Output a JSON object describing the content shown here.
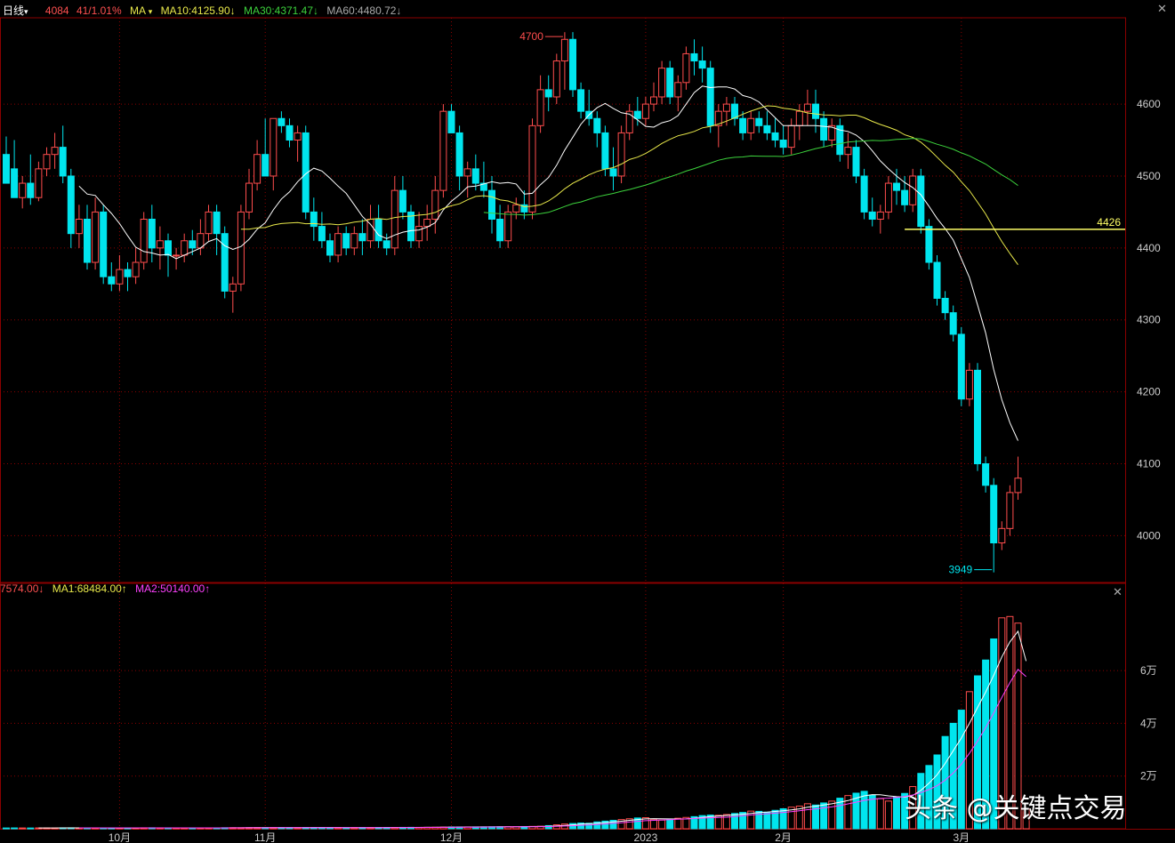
{
  "header": {
    "period": "日线",
    "period_arrow": "▾",
    "price": "4084",
    "change": "41/1.01%",
    "ma_label": "MA",
    "ma_arrow": "▾",
    "ma10": "MA10:4125.90↓",
    "ma30": "MA30:4371.47↓",
    "ma60": "MA60:4480.72↓"
  },
  "volume_header": {
    "vol": "7574.00↓",
    "ma1": "MA1:68484.00↑",
    "ma2": "MA2:50140.00↑"
  },
  "annotations": {
    "high_label": "4700",
    "low_label": "3949",
    "level_label": "4426",
    "level_value": 4426
  },
  "watermark": "头条 @关键点交易",
  "colors": {
    "up": "#ff4d4d",
    "down": "#00e5ee",
    "ma10": "#ffffff",
    "ma30": "#e8e84a",
    "ma60": "#3cd23c",
    "grid": "#8b0000",
    "level": "#ffff66",
    "vol_ma1": "#ffffff",
    "vol_ma2": "#ff40ff"
  },
  "chart_data": {
    "type": "candlestick",
    "price_axis": {
      "ticks": [
        4000,
        4100,
        4200,
        4300,
        4400,
        4500,
        4600
      ],
      "ylim": [
        3935,
        4720
      ]
    },
    "volume_axis": {
      "ticks": [
        "2万",
        "4万",
        "6万"
      ],
      "tick_values": [
        20000,
        40000,
        60000
      ],
      "ylim": [
        0,
        86000
      ]
    },
    "x_labels": [
      {
        "label": "10月",
        "index": 14
      },
      {
        "label": "11月",
        "index": 32
      },
      {
        "label": "12月",
        "index": 55
      },
      {
        "label": "2023",
        "index": 79
      },
      {
        "label": "2月",
        "index": 96
      },
      {
        "label": "3月",
        "index": 118
      }
    ],
    "candles": [
      [
        4530,
        4555,
        4510,
        4490
      ],
      [
        4510,
        4550,
        4470,
        4470
      ],
      [
        4470,
        4500,
        4455,
        4490
      ],
      [
        4490,
        4530,
        4460,
        4470
      ],
      [
        4470,
        4520,
        4465,
        4510
      ],
      [
        4510,
        4540,
        4500,
        4530
      ],
      [
        4530,
        4560,
        4510,
        4540
      ],
      [
        4540,
        4570,
        4490,
        4500
      ],
      [
        4500,
        4510,
        4400,
        4420
      ],
      [
        4420,
        4460,
        4400,
        4440
      ],
      [
        4440,
        4460,
        4370,
        4380
      ],
      [
        4380,
        4470,
        4370,
        4450
      ],
      [
        4450,
        4460,
        4350,
        4360
      ],
      [
        4360,
        4380,
        4340,
        4350
      ],
      [
        4350,
        4390,
        4340,
        4370
      ],
      [
        4370,
        4380,
        4340,
        4360
      ],
      [
        4360,
        4400,
        4350,
        4380
      ],
      [
        4380,
        4450,
        4370,
        4440
      ],
      [
        4440,
        4460,
        4380,
        4400
      ],
      [
        4400,
        4430,
        4370,
        4410
      ],
      [
        4410,
        4420,
        4360,
        4390
      ],
      [
        4390,
        4400,
        4370,
        4390
      ],
      [
        4390,
        4420,
        4380,
        4410
      ],
      [
        4410,
        4425,
        4390,
        4400
      ],
      [
        4400,
        4440,
        4390,
        4420
      ],
      [
        4420,
        4460,
        4410,
        4450
      ],
      [
        4450,
        4460,
        4390,
        4420
      ],
      [
        4420,
        4430,
        4330,
        4340
      ],
      [
        4340,
        4360,
        4310,
        4350
      ],
      [
        4350,
        4460,
        4340,
        4450
      ],
      [
        4450,
        4510,
        4440,
        4490
      ],
      [
        4490,
        4550,
        4480,
        4530
      ],
      [
        4530,
        4580,
        4500,
        4500
      ],
      [
        4500,
        4580,
        4480,
        4580
      ],
      [
        4580,
        4590,
        4560,
        4570
      ],
      [
        4570,
        4580,
        4540,
        4550
      ],
      [
        4550,
        4570,
        4520,
        4560
      ],
      [
        4560,
        4570,
        4440,
        4450
      ],
      [
        4450,
        4470,
        4410,
        4430
      ],
      [
        4430,
        4450,
        4400,
        4410
      ],
      [
        4410,
        4420,
        4380,
        4390
      ],
      [
        4390,
        4430,
        4380,
        4420
      ],
      [
        4420,
        4430,
        4390,
        4400
      ],
      [
        4400,
        4430,
        4390,
        4420
      ],
      [
        4420,
        4440,
        4390,
        4410
      ],
      [
        4410,
        4460,
        4400,
        4440
      ],
      [
        4440,
        4460,
        4400,
        4410
      ],
      [
        4410,
        4420,
        4390,
        4400
      ],
      [
        4400,
        4500,
        4390,
        4480
      ],
      [
        4480,
        4500,
        4440,
        4450
      ],
      [
        4450,
        4460,
        4400,
        4410
      ],
      [
        4410,
        4450,
        4400,
        4430
      ],
      [
        4430,
        4460,
        4410,
        4440
      ],
      [
        4440,
        4500,
        4420,
        4480
      ],
      [
        4480,
        4600,
        4470,
        4590
      ],
      [
        4590,
        4600,
        4560,
        4560
      ],
      [
        4560,
        4570,
        4480,
        4500
      ],
      [
        4500,
        4520,
        4470,
        4510
      ],
      [
        4510,
        4530,
        4480,
        4490
      ],
      [
        4490,
        4520,
        4470,
        4480
      ],
      [
        4480,
        4500,
        4420,
        4440
      ],
      [
        4440,
        4460,
        4400,
        4410
      ],
      [
        4410,
        4460,
        4400,
        4450
      ],
      [
        4450,
        4470,
        4440,
        4460
      ],
      [
        4460,
        4480,
        4440,
        4450
      ],
      [
        4450,
        4580,
        4440,
        4570
      ],
      [
        4570,
        4640,
        4560,
        4620
      ],
      [
        4620,
        4640,
        4590,
        4610
      ],
      [
        4610,
        4670,
        4600,
        4660
      ],
      [
        4660,
        4700,
        4620,
        4690
      ],
      [
        4690,
        4700,
        4610,
        4620
      ],
      [
        4620,
        4630,
        4580,
        4590
      ],
      [
        4590,
        4620,
        4570,
        4580
      ],
      [
        4580,
        4590,
        4540,
        4560
      ],
      [
        4560,
        4570,
        4500,
        4510
      ],
      [
        4510,
        4540,
        4480,
        4500
      ],
      [
        4500,
        4570,
        4490,
        4560
      ],
      [
        4560,
        4600,
        4550,
        4590
      ],
      [
        4590,
        4610,
        4570,
        4580
      ],
      [
        4580,
        4610,
        4570,
        4600
      ],
      [
        4600,
        4630,
        4590,
        4610
      ],
      [
        4610,
        4660,
        4600,
        4650
      ],
      [
        4650,
        4660,
        4600,
        4610
      ],
      [
        4610,
        4640,
        4590,
        4630
      ],
      [
        4630,
        4680,
        4620,
        4670
      ],
      [
        4670,
        4690,
        4640,
        4660
      ],
      [
        4660,
        4680,
        4630,
        4650
      ],
      [
        4650,
        4660,
        4560,
        4570
      ],
      [
        4570,
        4600,
        4540,
        4590
      ],
      [
        4590,
        4610,
        4570,
        4600
      ],
      [
        4600,
        4610,
        4570,
        4580
      ],
      [
        4580,
        4590,
        4550,
        4560
      ],
      [
        4560,
        4590,
        4550,
        4580
      ],
      [
        4580,
        4590,
        4560,
        4570
      ],
      [
        4570,
        4590,
        4550,
        4560
      ],
      [
        4560,
        4580,
        4540,
        4550
      ],
      [
        4550,
        4570,
        4530,
        4540
      ],
      [
        4540,
        4580,
        4530,
        4570
      ],
      [
        4570,
        4600,
        4550,
        4590
      ],
      [
        4590,
        4620,
        4570,
        4600
      ],
      [
        4600,
        4620,
        4560,
        4580
      ],
      [
        4580,
        4590,
        4540,
        4550
      ],
      [
        4550,
        4580,
        4540,
        4570
      ],
      [
        4570,
        4580,
        4520,
        4530
      ],
      [
        4530,
        4560,
        4510,
        4540
      ],
      [
        4540,
        4550,
        4490,
        4500
      ],
      [
        4500,
        4510,
        4440,
        4450
      ],
      [
        4450,
        4470,
        4430,
        4440
      ],
      [
        4440,
        4460,
        4420,
        4450
      ],
      [
        4450,
        4500,
        4440,
        4490
      ],
      [
        4490,
        4510,
        4460,
        4480
      ],
      [
        4480,
        4500,
        4450,
        4460
      ],
      [
        4460,
        4510,
        4450,
        4500
      ],
      [
        4500,
        4510,
        4420,
        4430
      ],
      [
        4430,
        4440,
        4370,
        4380
      ],
      [
        4380,
        4390,
        4320,
        4330
      ],
      [
        4330,
        4340,
        4300,
        4310
      ],
      [
        4310,
        4320,
        4270,
        4280
      ],
      [
        4280,
        4290,
        4180,
        4190
      ],
      [
        4190,
        4240,
        4180,
        4230
      ],
      [
        4230,
        4240,
        4090,
        4100
      ],
      [
        4100,
        4110,
        4060,
        4070
      ],
      [
        4070,
        4080,
        3949,
        3990
      ],
      [
        3990,
        4020,
        3980,
        4010
      ],
      [
        4010,
        4070,
        4000,
        4060
      ],
      [
        4060,
        4110,
        4050,
        4080
      ]
    ],
    "volume": [
      300,
      320,
      310,
      290,
      330,
      340,
      320,
      350,
      360,
      340,
      330,
      320,
      310,
      300,
      320,
      310,
      330,
      360,
      370,
      350,
      340,
      330,
      320,
      310,
      320,
      340,
      330,
      390,
      410,
      400,
      420,
      450,
      430,
      440,
      460,
      440,
      430,
      480,
      470,
      460,
      440,
      430,
      420,
      440,
      450,
      460,
      470,
      480,
      500,
      520,
      540,
      530,
      560,
      590,
      640,
      680,
      690,
      700,
      710,
      720,
      760,
      780,
      800,
      820,
      850,
      900,
      960,
      1200,
      1500,
      1800,
      2000,
      2200,
      2100,
      2600,
      2900,
      3200,
      3500,
      3800,
      4100,
      4200,
      3600,
      3300,
      3500,
      4000,
      4300,
      4600,
      5000,
      5200,
      5100,
      5400,
      5800,
      6200,
      6700,
      6600,
      6300,
      7000,
      7600,
      8200,
      8600,
      9500,
      9000,
      9800,
      10500,
      11600,
      12600,
      13500,
      14200,
      12800,
      11400,
      10500,
      12000,
      13400,
      16000,
      21000,
      24000,
      28000,
      35000,
      40000,
      45000,
      52000,
      58000,
      64000,
      72000,
      80000,
      80500,
      78000,
      7574
    ]
  }
}
